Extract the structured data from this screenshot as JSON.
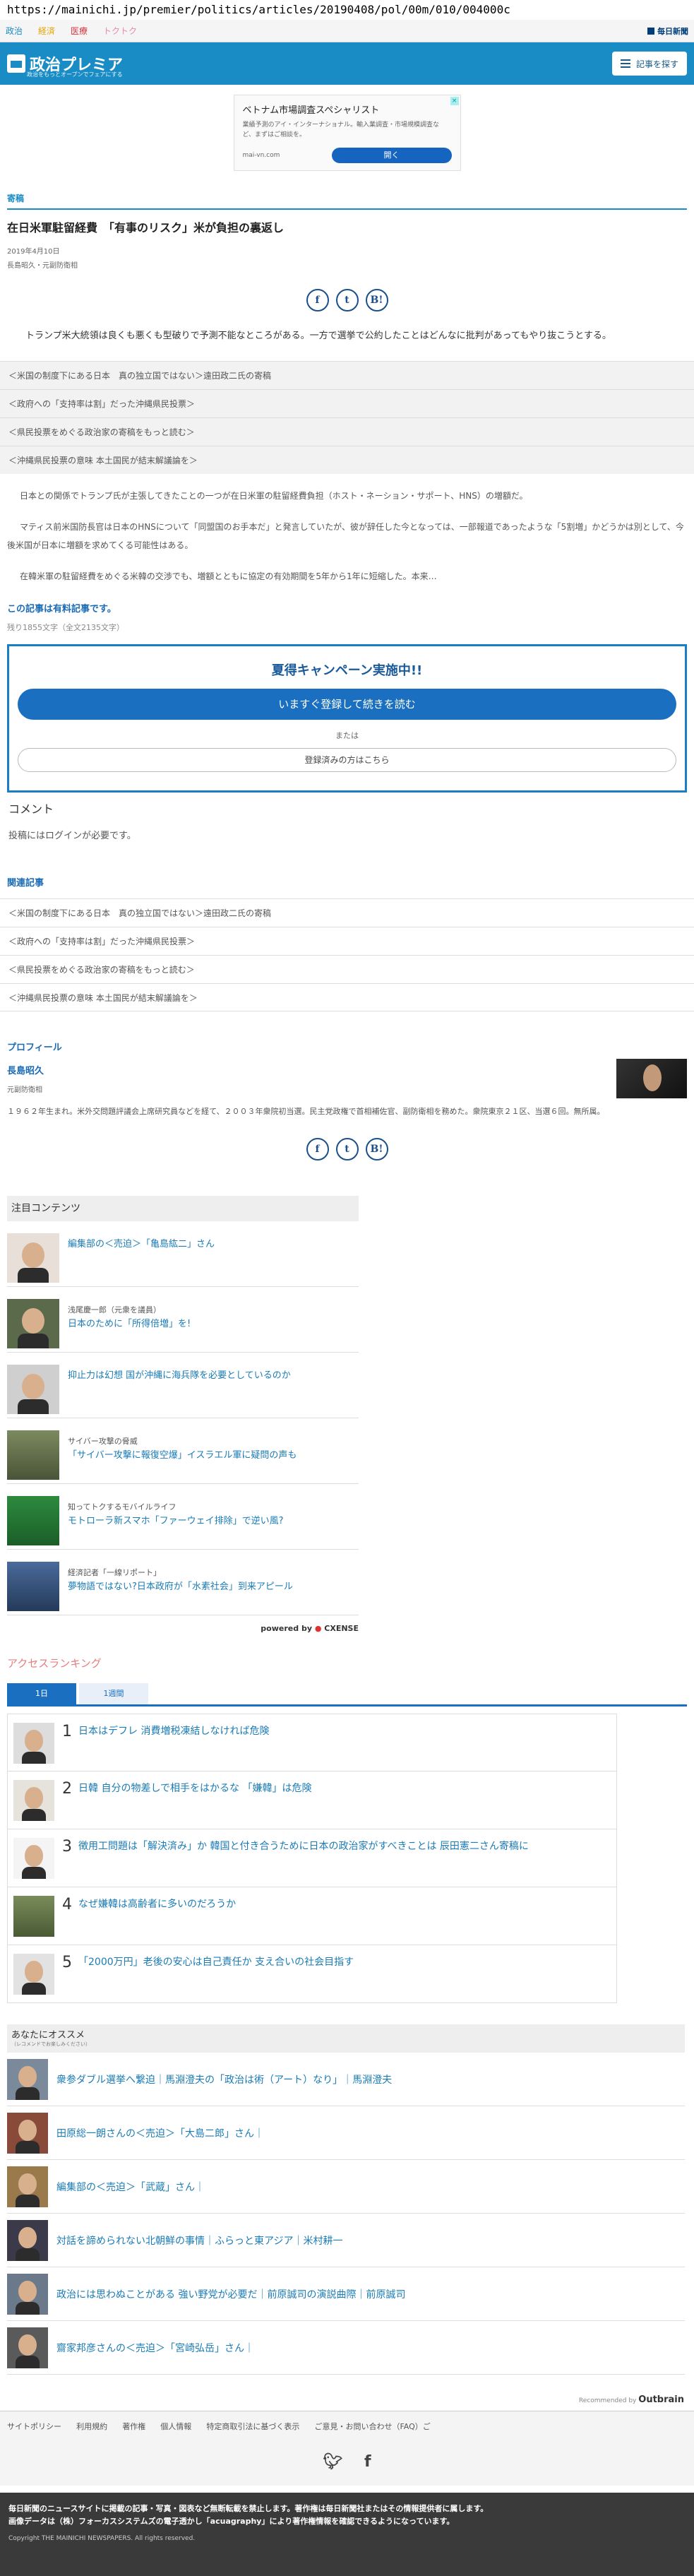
{
  "url": "https://mainichi.jp/premier/politics/articles/20190408/pol/00m/010/004000c",
  "site_nav": {
    "items": [
      "政治",
      "経済",
      "医療",
      "トクトク"
    ],
    "item_colors": [
      "#1a8cc5",
      "#e6a300",
      "#d9323c",
      "#e88aa8"
    ],
    "brand": "毎日新聞"
  },
  "header": {
    "logo_title": "政治プレミア",
    "logo_sub": "政治をもっとオープンでフェアにする",
    "search_label": "記事を探す"
  },
  "ad": {
    "title": "ベトナム市場調査スペシャリスト",
    "body": "業績予測のアイ・インターナショナル。輸入業調査・市場規模調査など、まずはご相談を。",
    "url": "mai-vn.com",
    "open_label": "開く",
    "close_label": "×"
  },
  "article": {
    "section": "寄稿",
    "title": "在日米軍駐留経費　「有事のリスク」米が負担の裏返し",
    "date": "2019年4月10日",
    "author_line": "長島昭久・元副防衛相",
    "lead": "トランプ米大統領は良くも悪くも型破りで予測不能なところがある。一方で選挙で公約したことはどんなに批判があってもやり抜こうとする。",
    "links": [
      "＜米国の制度下にある日本　真の独立国ではない＞遠田政二氏の寄稿",
      "＜政府への「支持率は割」だった沖縄県民投票＞",
      "＜県民投票をめぐる政治家の寄稿をもっと読む＞",
      "＜沖縄県民投票の意味 本土国民が結末解議論を＞"
    ],
    "paragraphs": [
      "日本との関係でトランプ氏が主張してきたことの一つが在日米軍の駐留経費負担（ホスト・ネーション・サポート、HNS）の増額だ。",
      "マティス前米国防長官は日本のHNSについて「同盟国のお手本だ」と発言していたが、彼が辞任した今となっては、一部報道であったような「5割増」かどうかは別として、今後米国が日本に増額を求めてくる可能性はある。",
      "在韓米軍の駐留経費をめぐる米韓の交渉でも、増額とともに協定の有効期間を5年から1年に短縮した。本来…"
    ],
    "paid_label": "この記事は有料記事です。",
    "remaining": "残り1855文字（全文2135文字）"
  },
  "campaign": {
    "title": "夏得キャンペーン実施中!!",
    "register_label": "いますぐ登録して続きを読む",
    "or_label": "または",
    "login_label": "登録済みの方はこちら"
  },
  "comments": {
    "heading": "コメント",
    "note": "投稿にはログインが必要です。"
  },
  "related": {
    "heading": "関連記事",
    "items": [
      "＜米国の制度下にある日本　真の独立国ではない＞遠田政二氏の寄稿",
      "＜政府への「支持率は割」だった沖縄県民投票＞",
      "＜県民投票をめぐる政治家の寄稿をもっと読む＞",
      "＜沖縄県民投票の意味 本土国民が結末解議論を＞"
    ]
  },
  "profile": {
    "heading": "プロフィール",
    "name": "長島昭久",
    "role": "元副防衛相",
    "bio": "１９６２年生まれ。米外交問題評議会上席研究員などを経て、２００３年衆院初当選。民主党政権で首相補佐官、副防衛相を務めた。衆院東京２１区、当選６回。無所属。"
  },
  "share_icons": [
    "f",
    "t",
    "B!"
  ],
  "featured": {
    "heading": "注目コンテンツ",
    "items": [
      {
        "kicker": "",
        "title": "編集部の＜売迫＞「亀島紘二」さん"
      },
      {
        "kicker": "浅尾慶一郎（元衆を議員）",
        "title": "日本のために「所得倍増」を!"
      },
      {
        "kicker": "",
        "title": "抑止力は幻想 国が沖縄に海兵隊を必要としているのか"
      },
      {
        "kicker": "サイバー攻撃の脅威",
        "title": "「サイバー攻撃に報復空爆」イスラエル軍に疑問の声も"
      },
      {
        "kicker": "知ってトクするモバイルライフ",
        "title": "モトローラ新スマホ「ファーウェイ排除」で逆い風?"
      },
      {
        "kicker": "経済記者「一線リポート」",
        "title": "夢物語ではない?日本政府が「水素社会」到来アピール"
      }
    ],
    "powered_by": "powered by",
    "powered_brand": "CXENSE"
  },
  "ranking": {
    "heading": "アクセスランキング",
    "tabs": [
      "1日",
      "1週間"
    ],
    "items": [
      {
        "rank": "1",
        "title": "日本はデフレ 消費増税凍結しなければ危険"
      },
      {
        "rank": "2",
        "title": "日韓 自分の物差しで相手をはかるな 「嫌韓」は危険"
      },
      {
        "rank": "3",
        "title": "徴用工問題は「解決済み」か 韓国と付き合うために日本の政治家がすべきことは 辰田憲二さん寄稿に"
      },
      {
        "rank": "4",
        "title": "なぜ嫌韓は高齢者に多いのだろうか"
      },
      {
        "rank": "5",
        "title": "「2000万円」老後の安心は自己責任か 支え合いの社会目指す"
      }
    ]
  },
  "recommend": {
    "heading": "あなたにオススメ",
    "sub": "（レコメンドでお楽しみください）",
    "items": [
      "衆参ダブル選挙へ繋迫｜馬淵澄夫の「政治は術（アート）なり」｜馬淵澄夫",
      "田原総一朗さんの＜売迫＞「大島二郎」さん｜",
      "編集部の＜売迫＞「武蔵」さん｜",
      "対話を諦められない北朝鮮の事情｜ふらっと東アジア｜米村耕一",
      "政治には思わぬことがある 強い野党が必要だ｜前原誠司の演説曲際｜前原誠司",
      "齋家邦彦さんの＜売迫＞「宮崎弘岳」さん｜"
    ],
    "recommended_by": "Recommended by",
    "recommended_brand": "Outbrain"
  },
  "footer": {
    "links": [
      "サイトポリシー",
      "利用規約",
      "著作権",
      "個人情報",
      "特定商取引法に基づく表示",
      "ご意見・お問い合わせ（FAQ）ご"
    ],
    "notice": "毎日新聞のニュースサイトに掲載の記事・写真・図表など無断転載を禁止します。著作権は毎日新聞社またはその情報提供者に属します。",
    "notice2": "画像データは（株）フォーカスシステムズの電子透かし「acuagraphy」により著作権情報を確認できるようになっています。",
    "copyright": "Copyright THE MAINICHI NEWSPAPERS. All rights reserved."
  }
}
